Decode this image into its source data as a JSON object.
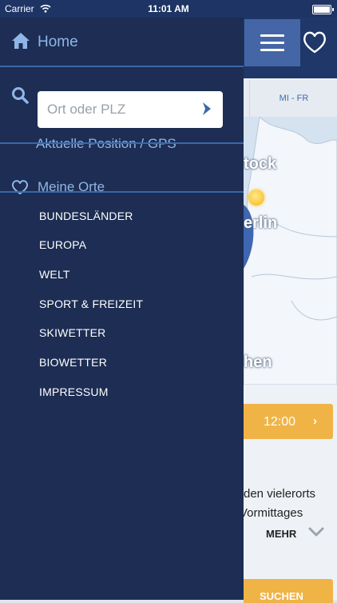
{
  "status_bar": {
    "carrier": "Carrier",
    "time": "11:01 AM"
  },
  "drawer": {
    "home_label": "Home",
    "search": {
      "placeholder": "Ort oder PLZ",
      "value": ""
    },
    "gps_link": "Aktuelle Position / GPS",
    "favorites_label": "Meine Orte",
    "menu_items": [
      "BUNDESLÄNDER",
      "EUROPA",
      "WELT",
      "SPORT & FREIZEIT",
      "SKIWETTER",
      "BIOWETTER",
      "IMPRESSUM"
    ]
  },
  "background": {
    "tab_label": "MI - FR",
    "map_labels": [
      "tock",
      "erlin",
      "hen"
    ],
    "time_selector": "12:00",
    "forecast_lines": [
      "rden vielerorts",
      "Vormittages"
    ],
    "more_label": "MEHR",
    "search_button": "SUCHEN"
  },
  "colors": {
    "drawer_bg": "#1d2d53",
    "accent_blue": "#8fb6e6",
    "divider": "#3a67a8",
    "orange": "#f0b346"
  },
  "icons": [
    "home-icon",
    "search-icon",
    "chevron-right-icon",
    "heart-icon",
    "hamburger-menu-icon",
    "chevron-down-icon",
    "wifi-icon",
    "battery-icon"
  ]
}
